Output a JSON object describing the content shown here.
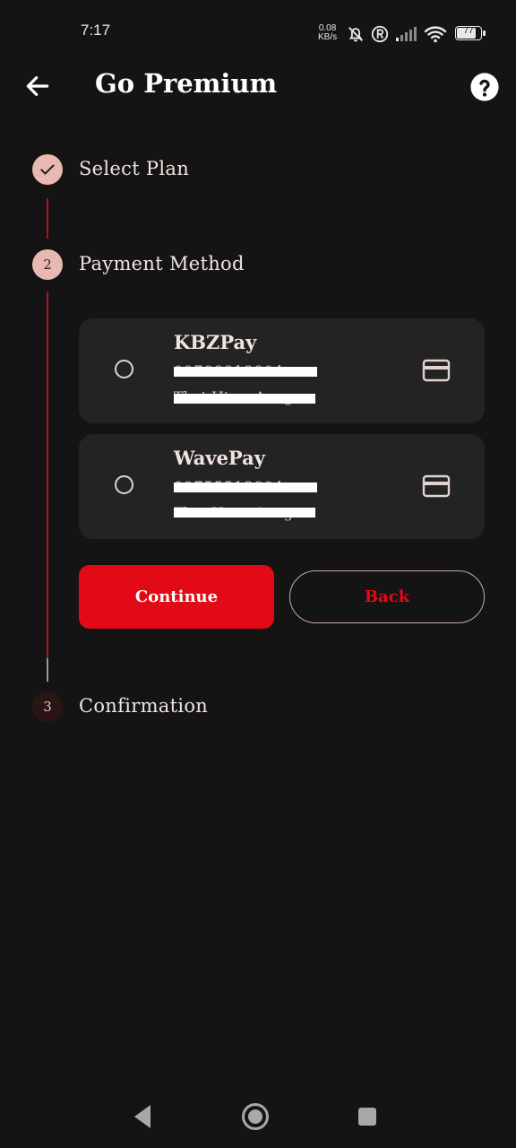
{
  "status_bar": {
    "time": "7:17",
    "net_speed_value": "0.08",
    "net_speed_unit": "KB/s",
    "battery": "77"
  },
  "app_bar": {
    "title": "Go Premium"
  },
  "steps": [
    {
      "number": "1",
      "label": "Select Plan",
      "state": "done"
    },
    {
      "number": "2",
      "label": "Payment Method",
      "state": "active"
    },
    {
      "number": "3",
      "label": "Confirmation",
      "state": "pending"
    }
  ],
  "payment_methods": [
    {
      "name": "KBZPay",
      "number": "09788813804",
      "holder": "Thet Htwe Aung"
    },
    {
      "name": "WavePay",
      "number": "09755513804",
      "holder": "Thet Htwe Aung"
    }
  ],
  "buttons": {
    "continue": "Continue",
    "back": "Back"
  },
  "colors": {
    "accent": "#e30a17",
    "step_fill": "#e8b9b2",
    "card_bg": "#232323",
    "background": "#141414"
  }
}
